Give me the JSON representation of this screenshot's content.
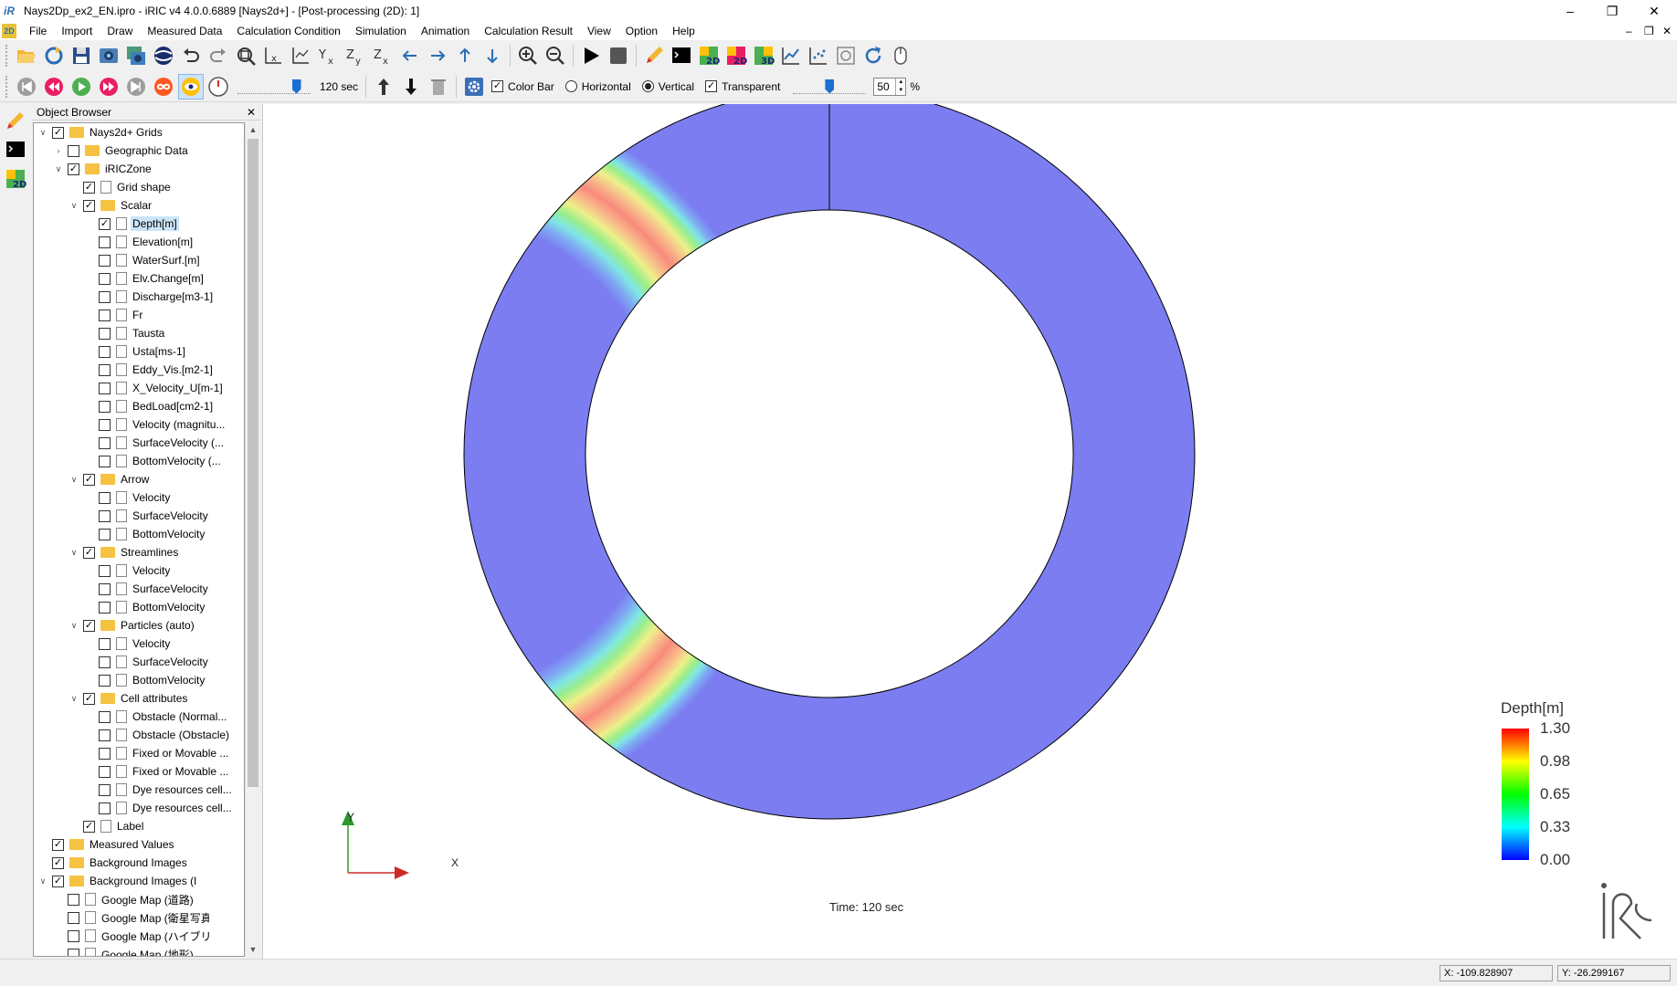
{
  "window": {
    "title": "Nays2Dp_ex2_EN.ipro - iRIC v4 4.0.0.6889 [Nays2d+] - [Post-processing (2D): 1]",
    "app_icon_text": "iR",
    "minimize": "–",
    "restore": "❐",
    "close": "✕"
  },
  "menubar": {
    "icon_text": "2D",
    "items": [
      "File",
      "Import",
      "Draw",
      "Measured Data",
      "Calculation Condition",
      "Simulation",
      "Animation",
      "Calculation Result",
      "View",
      "Option",
      "Help"
    ],
    "mdi_minimize": "–",
    "mdi_restore": "❐",
    "mdi_close": "✕"
  },
  "toolbar2": {
    "time_value": "120 sec",
    "time_slider_fraction": 0.85,
    "color_bar_label": "Color Bar",
    "color_bar_checked": "✓",
    "horizontal_label": "Horizontal",
    "vertical_label": "Vertical",
    "transparent_label": "Transparent",
    "transparent_checked": "✓",
    "transparency_slider_fraction": 0.5,
    "transparency_value": "50",
    "percent": "%"
  },
  "object_browser": {
    "title": "Object Browser",
    "close": "✕",
    "items": [
      {
        "label": "Nays2d+ Grids",
        "indent": 0,
        "exp": "v",
        "checked": true,
        "type": "folder"
      },
      {
        "label": "Geographic Data",
        "indent": 1,
        "exp": ">",
        "checked": false,
        "type": "folder"
      },
      {
        "label": "iRICZone",
        "indent": 1,
        "exp": "v",
        "checked": true,
        "type": "folder"
      },
      {
        "label": "Grid shape",
        "indent": 2,
        "exp": "",
        "checked": true,
        "type": "doc"
      },
      {
        "label": "Scalar",
        "indent": 2,
        "exp": "v",
        "checked": true,
        "type": "folder"
      },
      {
        "label": "Depth[m]",
        "indent": 3,
        "exp": "",
        "checked": true,
        "type": "doc",
        "selected": true
      },
      {
        "label": "Elevation[m]",
        "indent": 3,
        "exp": "",
        "checked": false,
        "type": "doc"
      },
      {
        "label": "WaterSurf.[m]",
        "indent": 3,
        "exp": "",
        "checked": false,
        "type": "doc"
      },
      {
        "label": "Elv.Change[m]",
        "indent": 3,
        "exp": "",
        "checked": false,
        "type": "doc"
      },
      {
        "label": "Discharge[m3-1]",
        "indent": 3,
        "exp": "",
        "checked": false,
        "type": "doc"
      },
      {
        "label": "Fr",
        "indent": 3,
        "exp": "",
        "checked": false,
        "type": "doc"
      },
      {
        "label": "Tausta",
        "indent": 3,
        "exp": "",
        "checked": false,
        "type": "doc"
      },
      {
        "label": "Usta[ms-1]",
        "indent": 3,
        "exp": "",
        "checked": false,
        "type": "doc"
      },
      {
        "label": "Eddy_Vis.[m2-1]",
        "indent": 3,
        "exp": "",
        "checked": false,
        "type": "doc"
      },
      {
        "label": "X_Velocity_U[m-1]",
        "indent": 3,
        "exp": "",
        "checked": false,
        "type": "doc"
      },
      {
        "label": "BedLoad[cm2-1]",
        "indent": 3,
        "exp": "",
        "checked": false,
        "type": "doc"
      },
      {
        "label": "Velocity (magnitu...",
        "indent": 3,
        "exp": "",
        "checked": false,
        "type": "doc"
      },
      {
        "label": "SurfaceVelocity (...",
        "indent": 3,
        "exp": "",
        "checked": false,
        "type": "doc"
      },
      {
        "label": "BottomVelocity (...",
        "indent": 3,
        "exp": "",
        "checked": false,
        "type": "doc"
      },
      {
        "label": "Arrow",
        "indent": 2,
        "exp": "v",
        "checked": true,
        "type": "folder"
      },
      {
        "label": "Velocity",
        "indent": 3,
        "exp": "",
        "checked": false,
        "type": "doc"
      },
      {
        "label": "SurfaceVelocity",
        "indent": 3,
        "exp": "",
        "checked": false,
        "type": "doc"
      },
      {
        "label": "BottomVelocity",
        "indent": 3,
        "exp": "",
        "checked": false,
        "type": "doc"
      },
      {
        "label": "Streamlines",
        "indent": 2,
        "exp": "v",
        "checked": true,
        "type": "folder"
      },
      {
        "label": "Velocity",
        "indent": 3,
        "exp": "",
        "checked": false,
        "type": "doc"
      },
      {
        "label": "SurfaceVelocity",
        "indent": 3,
        "exp": "",
        "checked": false,
        "type": "doc"
      },
      {
        "label": "BottomVelocity",
        "indent": 3,
        "exp": "",
        "checked": false,
        "type": "doc"
      },
      {
        "label": "Particles (auto)",
        "indent": 2,
        "exp": "v",
        "checked": true,
        "type": "folder"
      },
      {
        "label": "Velocity",
        "indent": 3,
        "exp": "",
        "checked": false,
        "type": "doc"
      },
      {
        "label": "SurfaceVelocity",
        "indent": 3,
        "exp": "",
        "checked": false,
        "type": "doc"
      },
      {
        "label": "BottomVelocity",
        "indent": 3,
        "exp": "",
        "checked": false,
        "type": "doc"
      },
      {
        "label": "Cell attributes",
        "indent": 2,
        "exp": "v",
        "checked": true,
        "type": "folder"
      },
      {
        "label": "Obstacle (Normal...",
        "indent": 3,
        "exp": "",
        "checked": false,
        "type": "doc"
      },
      {
        "label": "Obstacle (Obstacle)",
        "indent": 3,
        "exp": "",
        "checked": false,
        "type": "doc"
      },
      {
        "label": "Fixed or Movable ...",
        "indent": 3,
        "exp": "",
        "checked": false,
        "type": "doc"
      },
      {
        "label": "Fixed or Movable ...",
        "indent": 3,
        "exp": "",
        "checked": false,
        "type": "doc"
      },
      {
        "label": "Dye resources cell...",
        "indent": 3,
        "exp": "",
        "checked": false,
        "type": "doc"
      },
      {
        "label": "Dye resources cell...",
        "indent": 3,
        "exp": "",
        "checked": false,
        "type": "doc"
      },
      {
        "label": "Label",
        "indent": 2,
        "exp": "",
        "checked": true,
        "type": "doc"
      },
      {
        "label": "Measured Values",
        "indent": 0,
        "exp": "",
        "checked": true,
        "type": "folder"
      },
      {
        "label": "Background Images",
        "indent": 0,
        "exp": "",
        "checked": true,
        "type": "folder"
      },
      {
        "label": "Background Images (Internet)",
        "indent": 0,
        "exp": "v",
        "checked": true,
        "type": "folder"
      },
      {
        "label": "Google Map (道路)",
        "indent": 1,
        "exp": "",
        "checked": false,
        "type": "doc"
      },
      {
        "label": "Google Map (衛星写真)",
        "indent": 1,
        "exp": "",
        "checked": false,
        "type": "doc"
      },
      {
        "label": "Google Map (ハイブリッド)",
        "indent": 1,
        "exp": "",
        "checked": false,
        "type": "doc"
      },
      {
        "label": "Google Map (地形)",
        "indent": 1,
        "exp": "",
        "checked": false,
        "type": "doc"
      }
    ]
  },
  "view": {
    "colorbar_title": "Depth[m]",
    "colorbar_ticks": [
      "1.30",
      "0.98",
      "0.65",
      "0.33",
      "0.00"
    ],
    "colorbar_colors": [
      "#ff0000",
      "#ffff00",
      "#00ff00",
      "#00ffff",
      "#0000ff"
    ],
    "time_label": "Time:  120 sec",
    "axis_x": "X",
    "axis_y": "Y",
    "ring_colors": {
      "edge": "#7b7df0",
      "peak": "#f88a7c"
    }
  },
  "statusbar": {
    "x": "X: -109.828907",
    "y": "Y: -26.299167"
  }
}
